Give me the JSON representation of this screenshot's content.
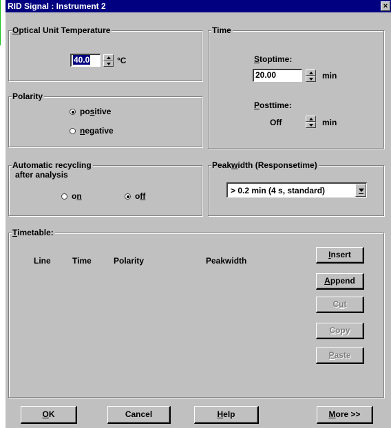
{
  "window": {
    "title": "RID Signal : Instrument 2",
    "close_glyph": "×"
  },
  "optical": {
    "label_prefix": "",
    "label_hot": "O",
    "label_rest": "ptical Unit Temperature",
    "value": "40.0",
    "unit": "°C"
  },
  "time": {
    "label": "Time",
    "stoptime": {
      "hot": "S",
      "rest": "toptime:",
      "value": "20.00",
      "unit": "min"
    },
    "posttime": {
      "hot": "P",
      "rest": "osttime:",
      "value": "Off",
      "unit": "min"
    }
  },
  "polarity": {
    "label": "Polarity",
    "positive": {
      "pre": "po",
      "hot": "s",
      "post": "itive",
      "selected": true
    },
    "negative": {
      "pre": "",
      "hot": "n",
      "post": "egative",
      "selected": false
    }
  },
  "recycling": {
    "label_line1": "Automatic recycling",
    "label_line2": "after analysis",
    "on": {
      "pre": "o",
      "hot": "n",
      "selected": false
    },
    "off": {
      "pre": "o",
      "hot": "ff",
      "selected": true
    }
  },
  "peakwidth": {
    "label_pre": "Peak",
    "label_hot": "w",
    "label_post": "idth (Responsetime)",
    "value": "> 0.2 min  (4 s, standard)"
  },
  "timetable": {
    "label_hot": "T",
    "label_rest": "imetable:",
    "columns": [
      "Line",
      "Time",
      "Polarity",
      "Peakwidth"
    ],
    "buttons": {
      "insert": {
        "hot": "I",
        "rest": "nsert"
      },
      "append": {
        "hot": "A",
        "rest": "ppend"
      },
      "cut": {
        "pre": "C",
        "hot": "u",
        "post": "t"
      },
      "copy": {
        "hot": "C",
        "rest": "opy"
      },
      "paste": {
        "hot": "P",
        "rest": "aste"
      }
    }
  },
  "footer": {
    "ok": {
      "hot": "O",
      "rest": "K"
    },
    "cancel": "Cancel",
    "help": {
      "hot": "H",
      "rest": "elp"
    },
    "more": {
      "hot": "M",
      "rest": "ore >>"
    }
  }
}
